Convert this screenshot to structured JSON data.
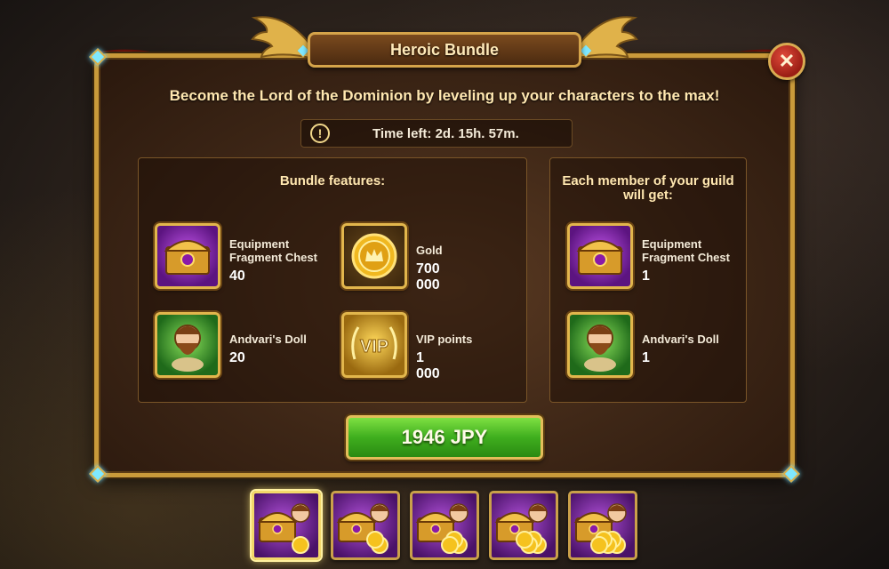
{
  "title": "Heroic Bundle",
  "subtitle": "Become the Lord of the Dominion by leveling up your characters to the max!",
  "timer": {
    "icon": "exclamation-icon",
    "text": "Time left: 2d. 15h. 57m."
  },
  "features": {
    "title": "Bundle features:",
    "items": [
      {
        "name_line1": "Equipment",
        "name_line2": "Fragment Chest",
        "qty": "40",
        "icon": "equipment-chest-icon"
      },
      {
        "name_line1": "Gold",
        "qty": "700 000",
        "icon": "gold-coin-icon"
      },
      {
        "name_line1": "Andvari's Doll",
        "qty": "20",
        "icon": "andvari-doll-icon"
      },
      {
        "name_line1": "VIP points",
        "qty": "1 000",
        "icon": "vip-icon",
        "icon_text": "VIP"
      }
    ]
  },
  "guild": {
    "title_line1": "Each member of your guild",
    "title_line2": "will get:",
    "items": [
      {
        "name_line1": "Equipment",
        "name_line2": "Fragment Chest",
        "qty": "1",
        "icon": "equipment-chest-icon"
      },
      {
        "name_line1": "Andvari's Doll",
        "qty": "1",
        "icon": "andvari-doll-icon"
      }
    ]
  },
  "buy_button": {
    "label": "1946 JPY"
  },
  "bundle_tabs": {
    "count": 5,
    "active_index": 0
  },
  "colors": {
    "gold_border": "#c99a3a",
    "button_green": "#3fae1e",
    "panel_bg": "#3d2616",
    "close_red": "#b02a1e"
  }
}
